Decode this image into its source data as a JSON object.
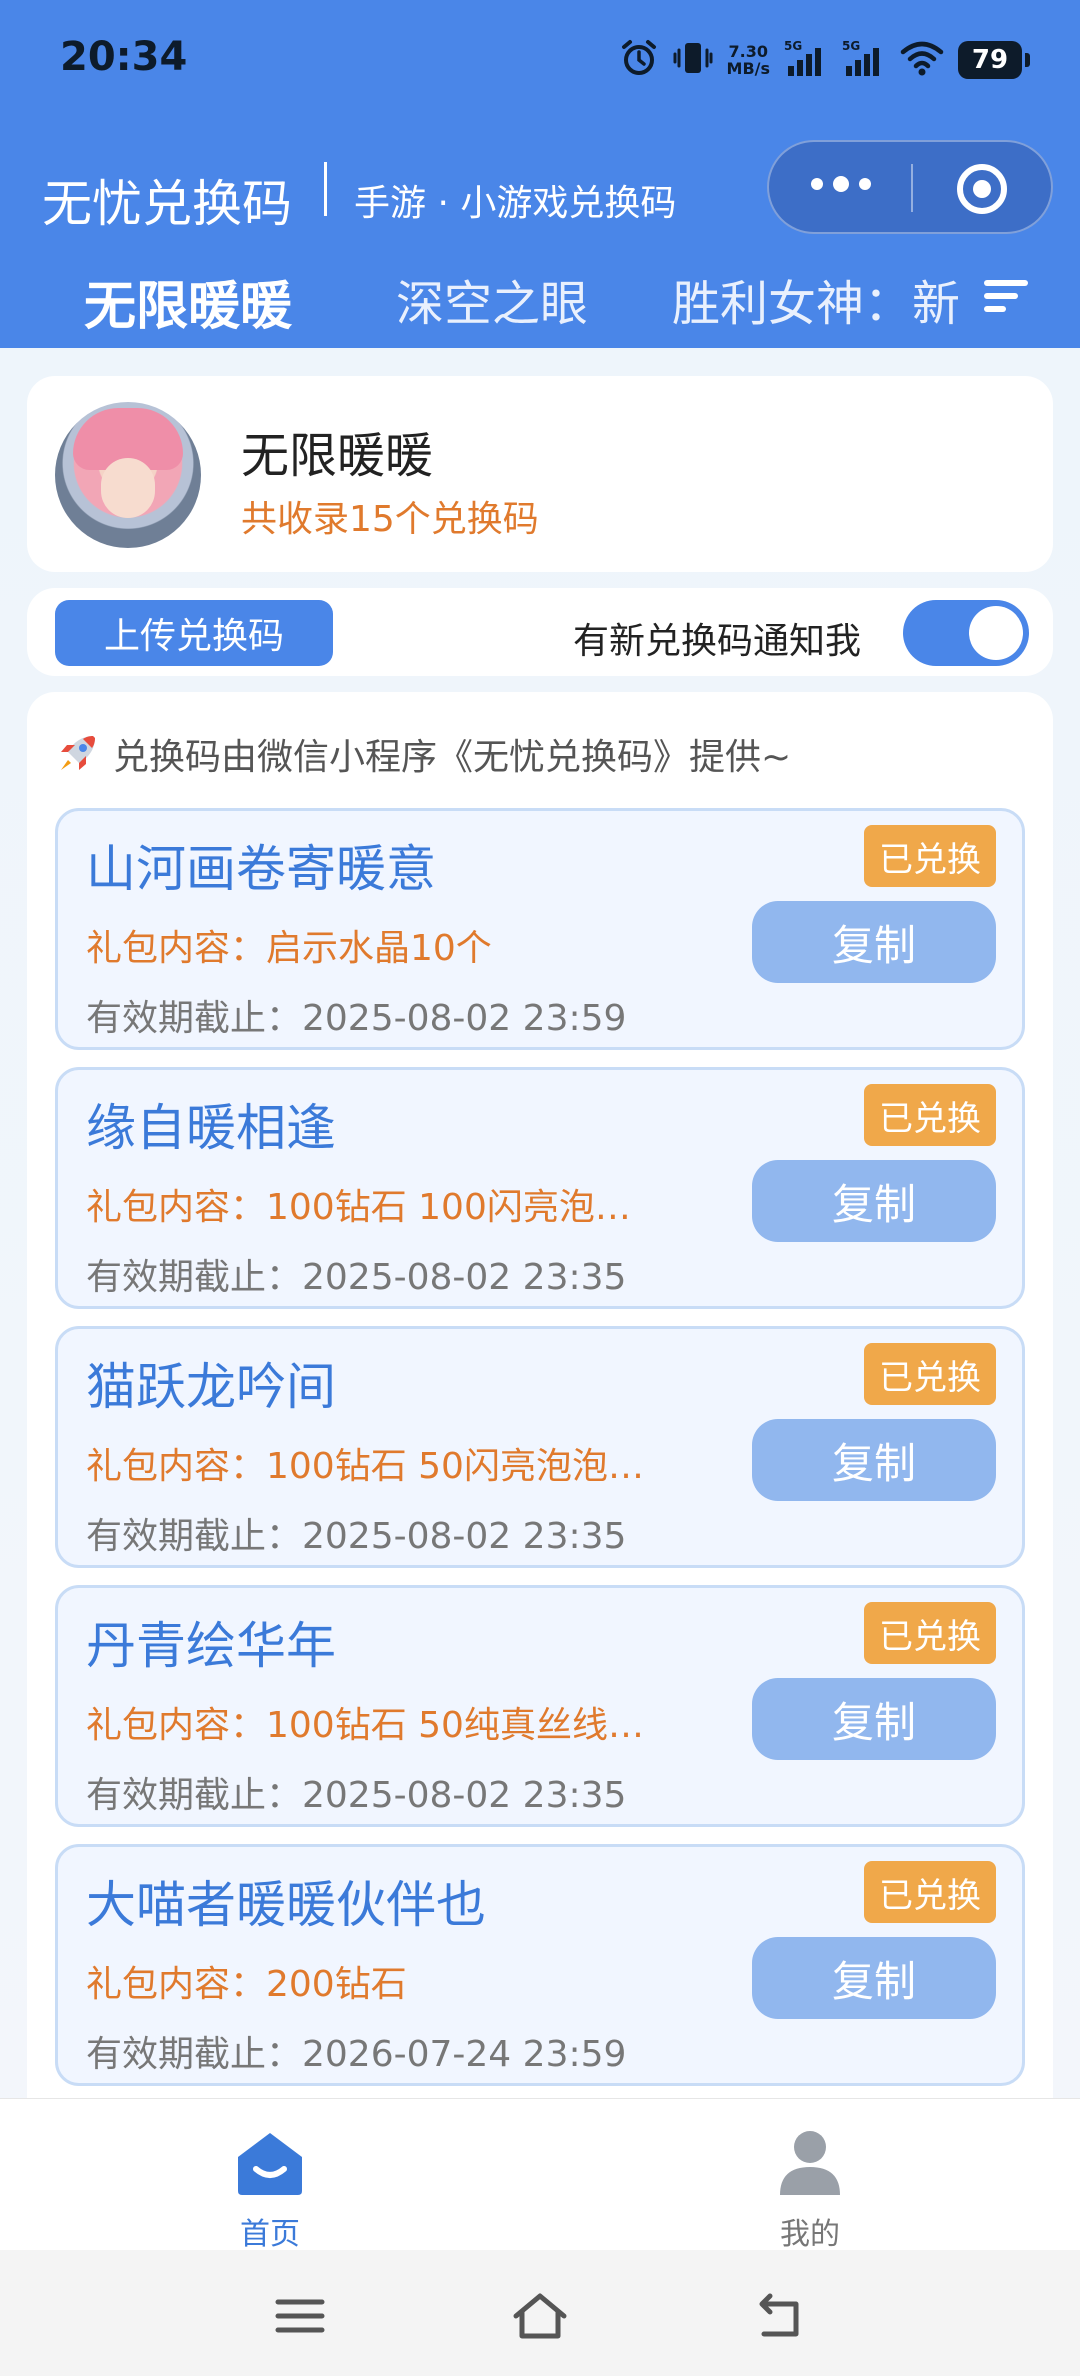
{
  "status_bar": {
    "time": "20:34",
    "network_speed_value": "7.30",
    "network_speed_unit": "MB/s",
    "sim1_label": "5G",
    "sim2_label": "5G",
    "battery_level": "79",
    "icons": [
      "alarm-icon",
      "vibrate-icon",
      "signal-icon",
      "signal-icon",
      "wifi-icon",
      "battery-icon"
    ]
  },
  "header": {
    "app_title": "无忧兑换码",
    "app_subtitle": "手游 · 小游戏兑换码",
    "capsule_icons": [
      "more-icon",
      "close-target-icon"
    ]
  },
  "tabs": {
    "items": [
      {
        "label": "无限暖暖",
        "active": true
      },
      {
        "label": "深空之眼",
        "active": false
      },
      {
        "label": "胜利女神：新",
        "active": false
      }
    ],
    "menu_icon": "list-menu-icon"
  },
  "game": {
    "name": "无限暖暖",
    "code_count_text": "共收录15个兑换码",
    "avatar_icon": "game-avatar"
  },
  "actions": {
    "upload_label": "上传兑换码",
    "notify_label": "有新兑换码通知我",
    "notify_enabled": true
  },
  "provider_note": "兑换码由微信小程序《无忧兑换码》提供~",
  "codes": [
    {
      "title": "山河画卷寄暖意",
      "content": "礼包内容：启示水晶10个",
      "expiry": "有效期截止：2025-08-02 23:59",
      "badge": "已兑换",
      "copy_label": "复制"
    },
    {
      "title": "缘自暖相逢",
      "content": "礼包内容：100钻石 100闪亮泡…",
      "expiry": "有效期截止：2025-08-02 23:35",
      "badge": "已兑换",
      "copy_label": "复制"
    },
    {
      "title": "猫跃龙吟间",
      "content": "礼包内容：100钻石 50闪亮泡泡…",
      "expiry": "有效期截止：2025-08-02 23:35",
      "badge": "已兑换",
      "copy_label": "复制"
    },
    {
      "title": "丹青绘华年",
      "content": "礼包内容：100钻石 50纯真丝线…",
      "expiry": "有效期截止：2025-08-02 23:35",
      "badge": "已兑换",
      "copy_label": "复制"
    },
    {
      "title": "大喵者暖暖伙伴也",
      "content": "礼包内容：200钻石",
      "expiry": "有效期截止：2026-07-24 23:59",
      "badge": "已兑换",
      "copy_label": "复制"
    }
  ],
  "bottom_tabs": [
    {
      "label": "首页",
      "icon": "home-icon",
      "active": true
    },
    {
      "label": "我的",
      "icon": "profile-icon",
      "active": false
    }
  ],
  "system_nav": [
    "menu-icon",
    "home-nav-icon",
    "back-icon"
  ],
  "colors": {
    "primary": "#4a86e8",
    "accent_orange": "#e07a2d",
    "badge_orange": "#f0a84a",
    "copy_button": "#91b7ee",
    "code_title": "#3b7ad9"
  }
}
